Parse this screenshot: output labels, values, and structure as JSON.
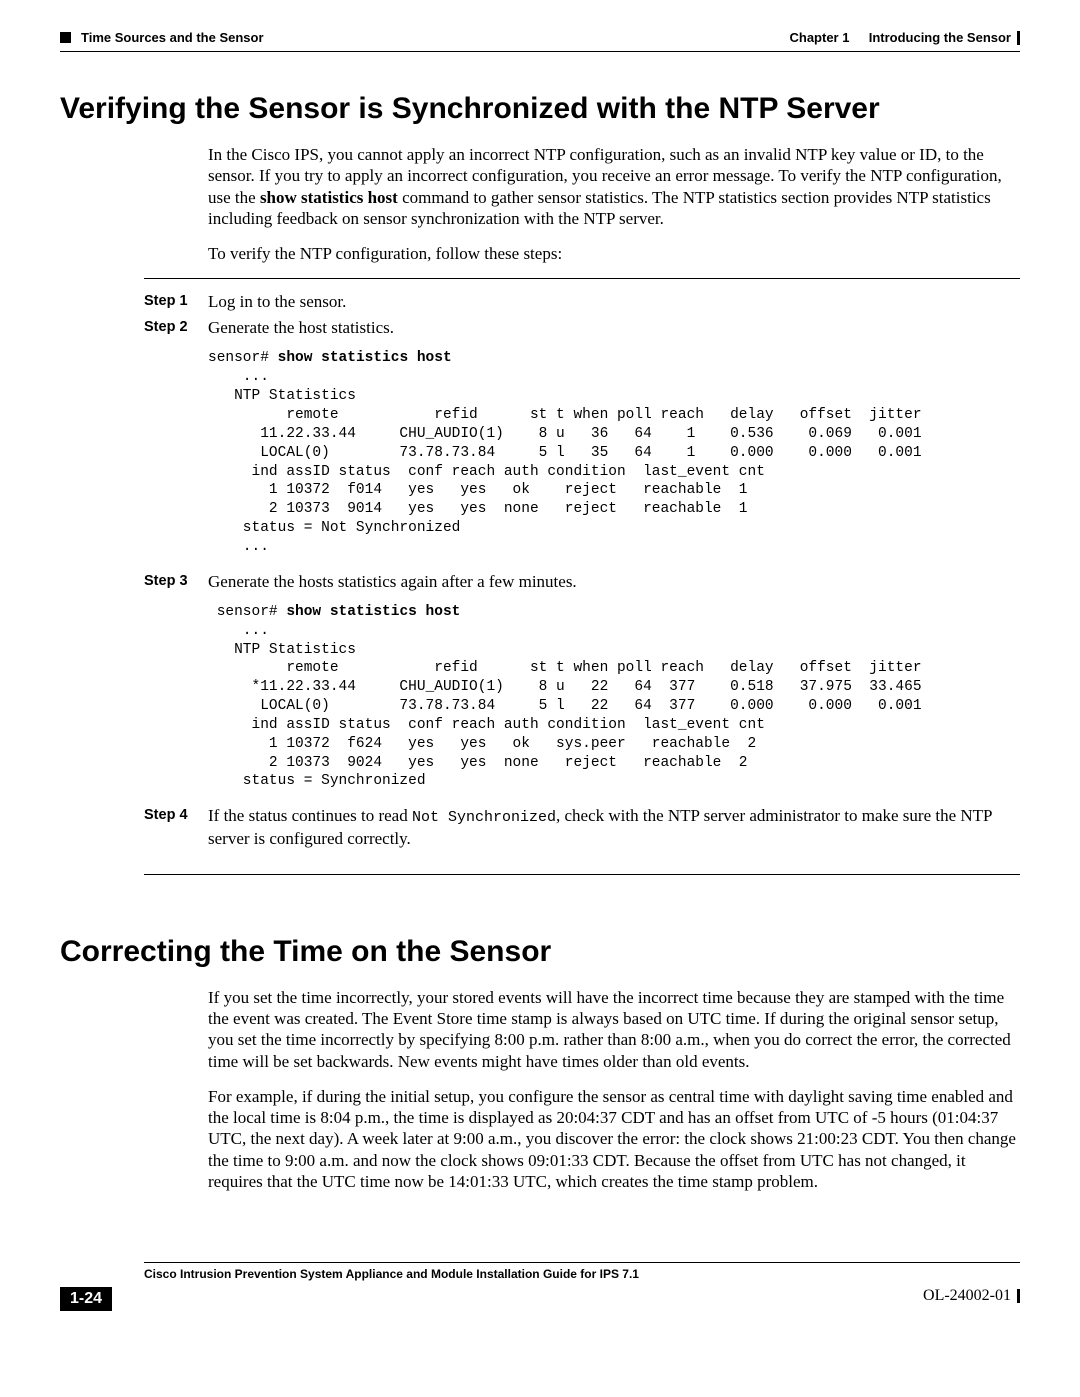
{
  "header": {
    "section_title": "Time Sources and the Sensor",
    "chapter_label": "Chapter 1",
    "chapter_title": "Introducing the Sensor"
  },
  "section1": {
    "heading": "Verifying the Sensor is Synchronized with the NTP Server",
    "para1_a": "In the Cisco IPS, you cannot apply an incorrect NTP configuration, such as an invalid NTP key value or ID, to the sensor. If you try to apply an incorrect configuration, you receive an error message. To verify the NTP configuration, use the ",
    "para1_bold": "show statistics host",
    "para1_b": " command to gather sensor statistics. The NTP statistics section provides NTP statistics including feedback on sensor synchronization with the NTP server.",
    "para2": "To verify the NTP configuration, follow these steps:",
    "steps": {
      "s1": {
        "label": "Step 1",
        "text": "Log in to the sensor."
      },
      "s2": {
        "label": "Step 2",
        "text": "Generate the host statistics.",
        "code_prompt": "sensor# ",
        "code_cmd": "show statistics host",
        "code_body": "    ...  \n   NTP Statistics  \n         remote           refid      st t when poll reach   delay   offset  jitter  \n      11.22.33.44     CHU_AUDIO(1)    8 u   36   64    1    0.536    0.069   0.001  \n      LOCAL(0)        73.78.73.84     5 l   35   64    1    0.000    0.000   0.001  \n     ind assID status  conf reach auth condition  last_event cnt  \n       1 10372  f014   yes   yes   ok    reject   reachable  1  \n       2 10373  9014   yes   yes  none   reject   reachable  1  \n    status = Not Synchronized\n    ..."
      },
      "s3": {
        "label": "Step 3",
        "text": "Generate the hosts statistics again after a few minutes.",
        "code_prompt": " sensor# ",
        "code_cmd": "show statistics host",
        "code_body": "    ...  \n   NTP Statistics  \n         remote           refid      st t when poll reach   delay   offset  jitter  \n     *11.22.33.44     CHU_AUDIO(1)    8 u   22   64  377    0.518   37.975  33.465  \n      LOCAL(0)        73.78.73.84     5 l   22   64  377    0.000    0.000   0.001  \n     ind assID status  conf reach auth condition  last_event cnt  \n       1 10372  f624   yes   yes   ok   sys.peer   reachable  2  \n       2 10373  9024   yes   yes  none   reject   reachable  2  \n    status = Synchronized"
      },
      "s4": {
        "label": "Step 4",
        "text_a": "If the status continues to read ",
        "code_inline": "Not Synchronized",
        "text_b": ", check with the NTP server administrator to make sure the NTP server is configured correctly."
      }
    }
  },
  "section2": {
    "heading": "Correcting the Time on the Sensor",
    "para1": "If you set the time incorrectly, your stored events will have the incorrect time because they are stamped with the time the event was created. The Event Store time stamp is always based on UTC time. If during the original sensor setup, you set the time incorrectly by specifying 8:00 p.m. rather than 8:00 a.m., when you do correct the error, the corrected time will be set backwards. New events might have times older than old events.",
    "para2": "For example, if during the initial setup, you configure the sensor as central time with daylight saving time enabled and the local time is 8:04 p.m., the time is displayed as 20:04:37 CDT and has an offset from UTC of -5 hours (01:04:37 UTC, the next day). A week later at 9:00 a.m., you discover the error: the clock shows 21:00:23 CDT. You then change the time to 9:00 a.m. and now the clock shows 09:01:33 CDT. Because the offset from UTC has not changed, it requires that the UTC time now be 14:01:33 UTC, which creates the time stamp problem."
  },
  "footer": {
    "doc_title": "Cisco Intrusion Prevention System Appliance and Module Installation Guide for IPS 7.1",
    "page_number": "1-24",
    "doc_id": "OL-24002-01"
  }
}
